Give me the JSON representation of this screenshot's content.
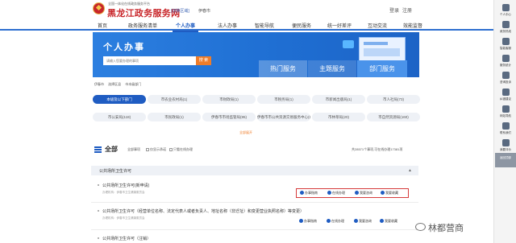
{
  "header": {
    "subtitle": "全国一体化在线政务服务平台",
    "title": "黑龙江政务服务网",
    "switch_region": "[切换区域]",
    "city": "伊春市",
    "login": "登录",
    "register": "注册"
  },
  "nav": {
    "items": [
      "首页",
      "政务服务清单",
      "个人办事",
      "法人办事",
      "智能导航",
      "便民服务",
      "统一好差评",
      "互动交流",
      "效能监督"
    ],
    "active": "个人办事"
  },
  "banner": {
    "title": "个人办事",
    "search_placeholder": "请输入您要办理的事项",
    "search_button": "搜 索",
    "tabs": [
      "热门服务",
      "主题服务",
      "部门服务"
    ],
    "active_tab": "部门服务"
  },
  "breadcrumb": [
    "伊春市",
    "选择区县",
    "市本级部门"
  ],
  "departments": [
    "本级及以下部门",
    "市农业农村局(1)",
    "市财政局(1)",
    "市税务局(1)",
    "市新闻出版局(1)",
    "市人社局(73)",
    "市公安局(118)",
    "市民政局(1)",
    "伊春市市场监管局(95)",
    "伊春市市公共资源交易服务中心(1)",
    "市林草局(20)",
    "市自然资源局(160)"
  ],
  "expand_label": "全部展开",
  "toolbar": {
    "all_label": "全部",
    "filters": [
      "全部事项",
      "仅显示承诺",
      "只看在线办理"
    ],
    "summary": "共28571个事项,可在线办理17381项"
  },
  "category": {
    "title": "公共场所卫生许可"
  },
  "items": [
    {
      "title": "公共场所卫生许可(新申请)",
      "meta": "办理机构：伊春市卫生健康委员会"
    },
    {
      "title": "公共场所卫生许可（经营单位名称、法定代表人或者负责人、地址名称（非迁址）和变更营业执照名称）等变更）",
      "meta": "办理机构：伊春市卫生健康委员会"
    },
    {
      "title": "公共场所卫生许可（注销）",
      "meta": ""
    }
  ],
  "actions": [
    "办事指南",
    "在线办理",
    "我要咨询",
    "我要收藏"
  ],
  "side_toolbar": {
    "items": [
      "个人中心",
      "政务热线",
      "智能客服",
      "服务统计",
      "咨询投诉",
      "纠错建议",
      "网站导航",
      "联系我们",
      "我要评价"
    ],
    "top_label": "返回顶部"
  },
  "watermark": "林都营商",
  "colors": {
    "brand_red": "#c8262a",
    "primary_blue": "#1f5cc2",
    "banner_blue": "#2c7fe0",
    "search_orange": "#ef7d2a",
    "highlight_red": "#d63b3b"
  }
}
